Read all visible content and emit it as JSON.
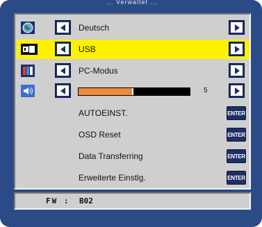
{
  "header": {
    "title": "... Verwaltet ..."
  },
  "menu": {
    "language": {
      "label": "Deutsch"
    },
    "input": {
      "label": "USB"
    },
    "mode": {
      "label": "PC-Modus"
    },
    "volume": {
      "value": 5,
      "value_text": "5",
      "fill_fraction": 0.48
    },
    "auto_adjust": {
      "label": "AUTOEINST.",
      "button": "ENTER"
    },
    "osd_reset": {
      "label": "OSD Reset",
      "button": "ENTER"
    },
    "data_transfer": {
      "label": "Data Transferring",
      "button": "ENTER"
    },
    "advanced": {
      "label": "Erweiterte Einstlg.",
      "button": "ENTER"
    }
  },
  "firmware": {
    "label": "FW :",
    "value": "B02"
  },
  "colors": {
    "frame": "#2b4b86",
    "panel": "#cfcfcf",
    "highlight": "#fff200",
    "button": "#1e2f66",
    "slider_fill": "#f08a3a"
  }
}
